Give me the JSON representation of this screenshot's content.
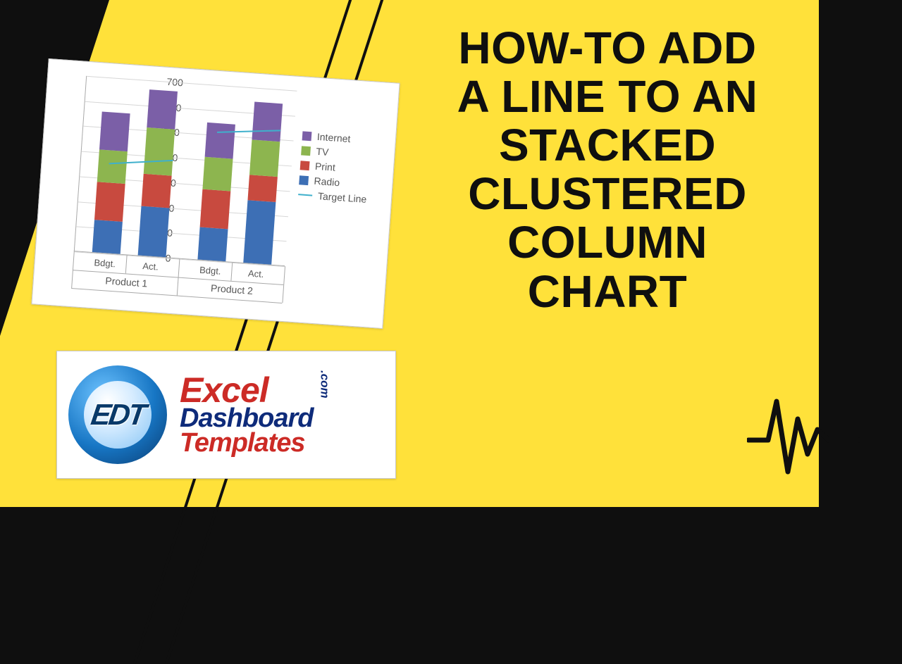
{
  "title_line1": "HOW-TO ADD",
  "title_line2": "A LINE TO AN",
  "title_line3": "STACKED",
  "title_line4": "CLUSTERED",
  "title_line5": "COLUMN",
  "title_line6": "CHART",
  "logo": {
    "badge_text": "EDT",
    "word1": "Excel",
    "word2": "Dashboard",
    "word3": "Templates",
    "tld": ".com"
  },
  "chart_data": {
    "type": "bar",
    "stacked": true,
    "clustered": true,
    "title": "",
    "xlabel": "",
    "ylabel": "",
    "ylim": [
      0,
      700
    ],
    "yticks": [
      0,
      100,
      200,
      300,
      400,
      500,
      600,
      700
    ],
    "groups": [
      "Product 1",
      "Product 2"
    ],
    "subcategories": [
      "Bdgt.",
      "Act."
    ],
    "series": [
      {
        "name": "Radio",
        "color": "#3d6fb5",
        "values": [
          130,
          195,
          130,
          250
        ]
      },
      {
        "name": "Print",
        "color": "#c84a3f",
        "values": [
          150,
          130,
          150,
          100
        ]
      },
      {
        "name": "TV",
        "color": "#8db54f",
        "values": [
          130,
          185,
          130,
          140
        ]
      },
      {
        "name": "Internet",
        "color": "#7b5fa7",
        "values": [
          150,
          150,
          135,
          150
        ]
      }
    ],
    "target_line": {
      "name": "Target Line",
      "color": "#3fb0cc",
      "segments": [
        {
          "group": "Product 1",
          "y_start": 360,
          "y_end": 390
        },
        {
          "group": "Product 2",
          "y_start": 515,
          "y_end": 540
        }
      ]
    },
    "legend": [
      "Internet",
      "TV",
      "Print",
      "Radio",
      "Target Line"
    ]
  }
}
